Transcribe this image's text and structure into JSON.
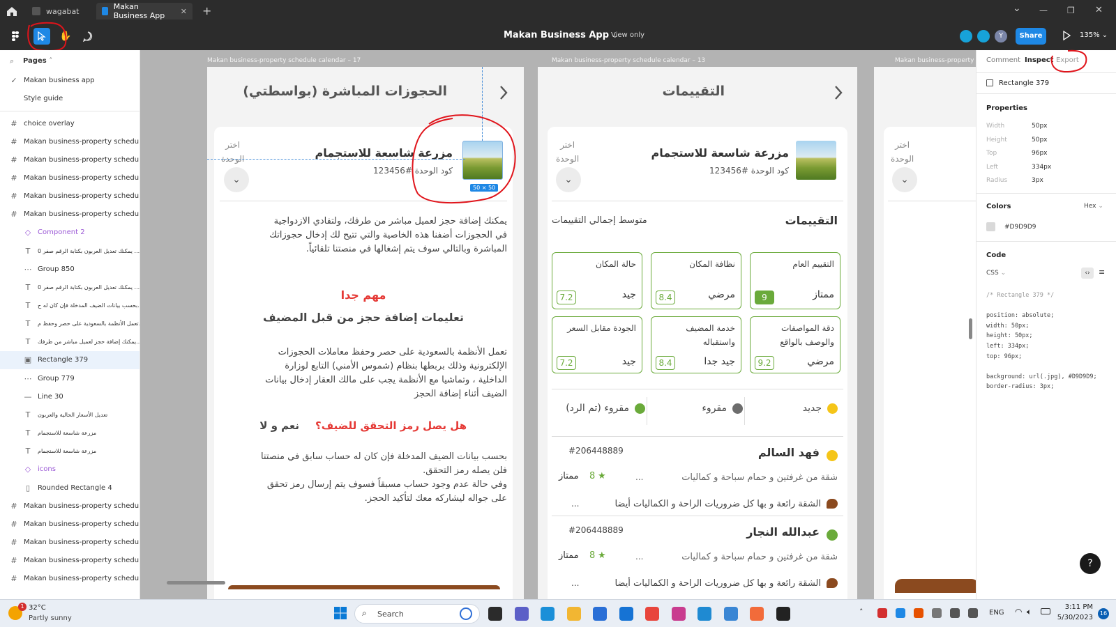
{
  "tabs": {
    "home_icon": "home-icon",
    "items": [
      {
        "label": "wagabat",
        "active": false
      },
      {
        "label": "Makan Business App",
        "active": true
      }
    ],
    "new_tab": "+"
  },
  "window": {
    "min": "—",
    "max": "❐",
    "close": "✕",
    "chevron": "⌄"
  },
  "toolbar": {
    "file_name": "Makan Business App",
    "mode": "View only",
    "share": "Share",
    "zoom": "135%",
    "avatar_letter": "Y"
  },
  "left_panel": {
    "pages_header": "Pages",
    "pages": [
      {
        "label": "Makan business app",
        "selected": true
      },
      {
        "label": "Style guide",
        "selected": false
      }
    ],
    "layers": [
      {
        "icon": "frame",
        "label": "choice overlay",
        "indent": 0
      },
      {
        "icon": "frame",
        "label": "Makan business-property schedu...",
        "indent": 0
      },
      {
        "icon": "frame",
        "label": "Makan business-property schedu...",
        "indent": 0
      },
      {
        "icon": "frame",
        "label": "Makan business-property schedu...",
        "indent": 0
      },
      {
        "icon": "frame",
        "label": "Makan business-property schedu...",
        "indent": 0
      },
      {
        "icon": "frame",
        "label": "Makan business-property schedu...",
        "indent": 0
      },
      {
        "icon": "component",
        "label": "Component 2",
        "indent": 1
      },
      {
        "icon": "text",
        "label": "يمكنك تعديل العربون بكتابة الرقم صفر 0 ...",
        "indent": 1
      },
      {
        "icon": "group",
        "label": "Group 850",
        "indent": 1
      },
      {
        "icon": "text",
        "label": "يمكنك تعديل العربون بكتابة الرقم صفر 0 ...",
        "indent": 1
      },
      {
        "icon": "text",
        "label": "بحسب بيانات الضيف المدخلة فإن كان له ح...",
        "indent": 1
      },
      {
        "icon": "text",
        "label": "تعمل الأنظمة بالسعودية على حصر وحفظ م...",
        "indent": 1
      },
      {
        "icon": "text",
        "label": "يمكنك إضافة حجز لعميل مباشر من طرفك...",
        "indent": 1
      },
      {
        "icon": "image",
        "label": "Rectangle 379",
        "indent": 1,
        "selected": true
      },
      {
        "icon": "group",
        "label": "Group 779",
        "indent": 1
      },
      {
        "icon": "line",
        "label": "Line 30",
        "indent": 1
      },
      {
        "icon": "text",
        "label": "تعديل الأسعار الحالية والعربون",
        "indent": 1
      },
      {
        "icon": "text",
        "label": "مزرعة شاسعة للاستجمام",
        "indent": 1
      },
      {
        "icon": "text",
        "label": "مزرعة شاسعة للاستجمام",
        "indent": 1
      },
      {
        "icon": "component",
        "label": "icons",
        "indent": 1
      },
      {
        "icon": "rect",
        "label": "Rounded Rectangle 4",
        "indent": 1
      },
      {
        "icon": "frame",
        "label": "Makan business-property schedu...",
        "indent": 0
      },
      {
        "icon": "frame",
        "label": "Makan business-property schedu...",
        "indent": 0
      },
      {
        "icon": "frame",
        "label": "Makan business-property schedu...",
        "indent": 0
      },
      {
        "icon": "frame",
        "label": "Makan business-property schedu...",
        "indent": 0
      },
      {
        "icon": "frame",
        "label": "Makan business-property schedu...",
        "indent": 0
      }
    ]
  },
  "canvas": {
    "frame_labels": [
      "Makan business-property schedule calendar – 17",
      "Makan business-property schedule calendar – 13",
      "Makan business-property s"
    ],
    "frame1": {
      "header": "الحجوزات المباشرة (بواسطتي)",
      "unit_title": "مزرعة شاسعة للاستجمام",
      "unit_code": "كود الوحدة  #123456",
      "choose_unit": "اختر\nالوحدة",
      "size_badge": "50 × 50",
      "intro": [
        "يمكنك إضافة حجز لعميل مباشر من طرفك، ولتفادي الازدواجية",
        "في الحجوزات أضفنا هذه الخاصية والتي تتيح لك إدخال حجوزاتك",
        "المباشرة وبالتالي سوف يتم إشغالها في منصتنا تلقائياً."
      ],
      "important": "مهم جدا",
      "instructions_title": "تعليمات إضافة حجز من قبل المضيف",
      "rules": [
        "تعمل الأنظمة بالسعودية على حصر وحفظ معاملات الحجوزات",
        "الإلكترونية وذلك بربطها بنظام (شموس الأمني) التابع لوزارة",
        "الداخلية ، وتماشيا مع الأنظمة يجب على مالك العقار إدخال بيانات",
        "الضيف أثناء إضافة الحجز"
      ],
      "question": "هل يصل رمز التحقق للضيف؟",
      "answer": "نعم و لا",
      "details": [
        "بحسب بيانات الضيف المدخلة فإن كان له حساب سابق في منصتنا",
        "فلن يصله رمز التحقق.",
        "وفي حالة عدم وجود حساب مسبقاً فسوف يتم إرسال رمز تحقق",
        "على جواله ليشاركه معك لتأكيد الحجز."
      ]
    },
    "frame2": {
      "header": "التقييمات",
      "unit_title": "مزرعة شاسعة للاستجمام",
      "unit_code": "كود الوحدة  #123456",
      "choose_unit": "اختر\nالوحدة",
      "ratings_title": "التقييمات",
      "avg_label": "متوسط إجمالي التقييمات",
      "ratings": [
        {
          "name": "التقييم العام",
          "verdict": "ممتاز",
          "score": "9",
          "filled": true
        },
        {
          "name": "نظافة المكان",
          "verdict": "مرضي",
          "score": "8.4",
          "filled": false
        },
        {
          "name": "حالة المكان",
          "verdict": "جيد",
          "score": "7.2",
          "filled": false
        },
        {
          "name": "دقة المواصفات\nوالوصف بالواقع",
          "verdict": "مرضي",
          "score": "9.2",
          "filled": false
        },
        {
          "name": "خدمة المضيف\nواستقباله",
          "verdict": "جيد جدا",
          "score": "8.4",
          "filled": false
        },
        {
          "name": "الجودة مقابل السعر",
          "verdict": "جيد",
          "score": "7.2",
          "filled": false
        }
      ],
      "filters": [
        {
          "label": "جديد",
          "color": "#f5c518"
        },
        {
          "label": "مقروء",
          "color": "#6d6d6d"
        },
        {
          "label": "مقروء (تم الرد)",
          "color": "#6aaa3a"
        }
      ],
      "reviews": [
        {
          "name": "فهد السالم",
          "id": "#206448889",
          "dot": "#f5c518",
          "summary": "شقة من غرفتين و حمام سباحة و كماليات",
          "more": "...",
          "stars": "8",
          "verdict": "ممتاز",
          "comment": "الشقة رائعة و بها كل ضروريات الراحة و الكماليات أيضا",
          "comment_more": "..."
        },
        {
          "name": "عبدالله النجار",
          "id": "#206448889",
          "dot": "#6aaa3a",
          "summary": "شقة من غرفتين و حمام سباحة و كماليات",
          "more": "...",
          "stars": "8",
          "verdict": "ممتاز",
          "comment": "الشقة رائعة و بها كل ضروريات الراحة و الكماليات أيضا",
          "comment_more": "..."
        }
      ]
    },
    "frame3": {
      "choose_unit": "اختر\nالوحدة"
    }
  },
  "right_panel": {
    "tabs": [
      "Comment",
      "Inspect",
      "Export"
    ],
    "layer_name": "Rectangle 379",
    "properties_title": "Properties",
    "properties": [
      {
        "k": "Width",
        "v": "50px"
      },
      {
        "k": "Height",
        "v": "50px"
      },
      {
        "k": "Top",
        "v": "96px"
      },
      {
        "k": "Left",
        "v": "334px"
      },
      {
        "k": "Radius",
        "v": "3px"
      }
    ],
    "colors_title": "Colors",
    "color_format": "Hex",
    "color_value": "#D9D9D9",
    "code_title": "Code",
    "code_lang": "CSS",
    "code_lines": [
      "/* Rectangle 379 */",
      "",
      "position: absolute;",
      "width: 50px;",
      "height: 50px;",
      "left: 334px;",
      "top: 96px;",
      "",
      "background: url(.jpg), #D9D9D9;",
      "border-radius: 3px;"
    ],
    "help": "?"
  },
  "taskbar": {
    "weather_temp": "32°C",
    "weather_desc": "Partly sunny",
    "weather_badge": "1",
    "search": "Search",
    "lang": "ENG",
    "time": "3:11 PM",
    "date": "5/30/2023",
    "notif": "16"
  }
}
